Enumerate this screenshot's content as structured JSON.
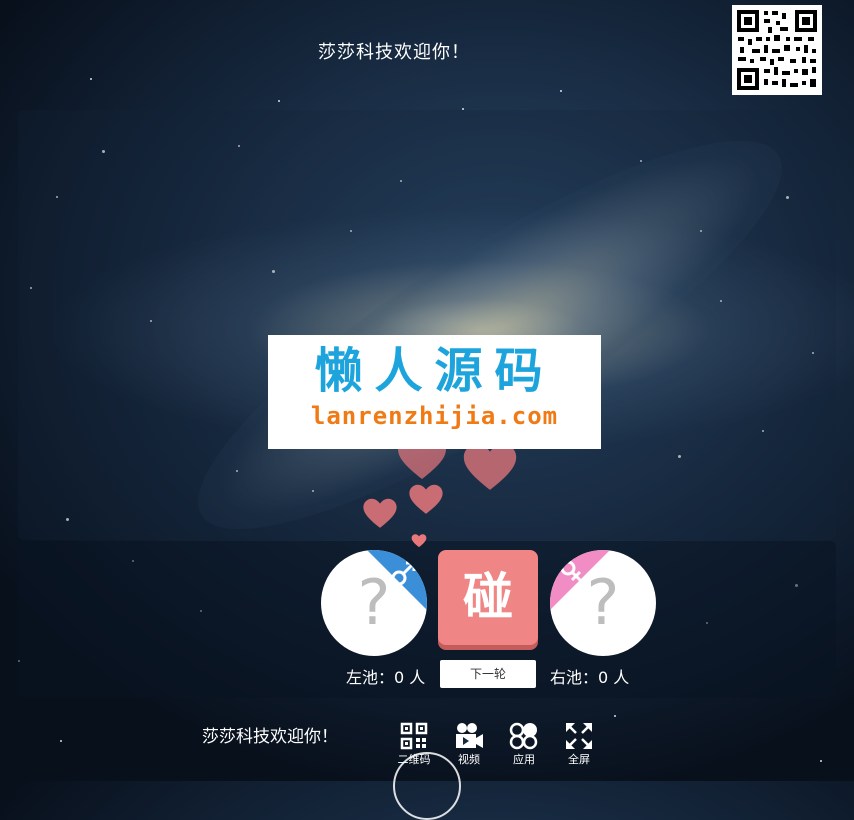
{
  "header": {
    "title": "莎莎科技欢迎你！"
  },
  "qr": {
    "icon": "qr-code-image"
  },
  "watermark": {
    "title": "懒人源码",
    "url": "lanrenzhijia.com"
  },
  "game": {
    "left_placeholder": "?",
    "right_placeholder": "?",
    "bump_label": "碰",
    "left_pool_label": "左池：0 人",
    "right_pool_label": "右池：0 人",
    "next_round_label": "下一轮",
    "male_icon": "male-symbol-icon",
    "female_icon": "female-symbol-icon"
  },
  "footer": {
    "welcome": "莎莎科技欢迎你！",
    "items": [
      {
        "label": "二维码",
        "icon": "qr-code-icon"
      },
      {
        "label": "视频",
        "icon": "video-camera-icon"
      },
      {
        "label": "应用",
        "icon": "apps-icon"
      },
      {
        "label": "全屏",
        "icon": "fullscreen-icon"
      }
    ]
  },
  "colors": {
    "male_accent": "#3b8fd8",
    "female_accent": "#f28cc4",
    "bump_button": "#f08585",
    "watermark_blue": "#1ea4dc",
    "watermark_orange": "#f07a14"
  }
}
